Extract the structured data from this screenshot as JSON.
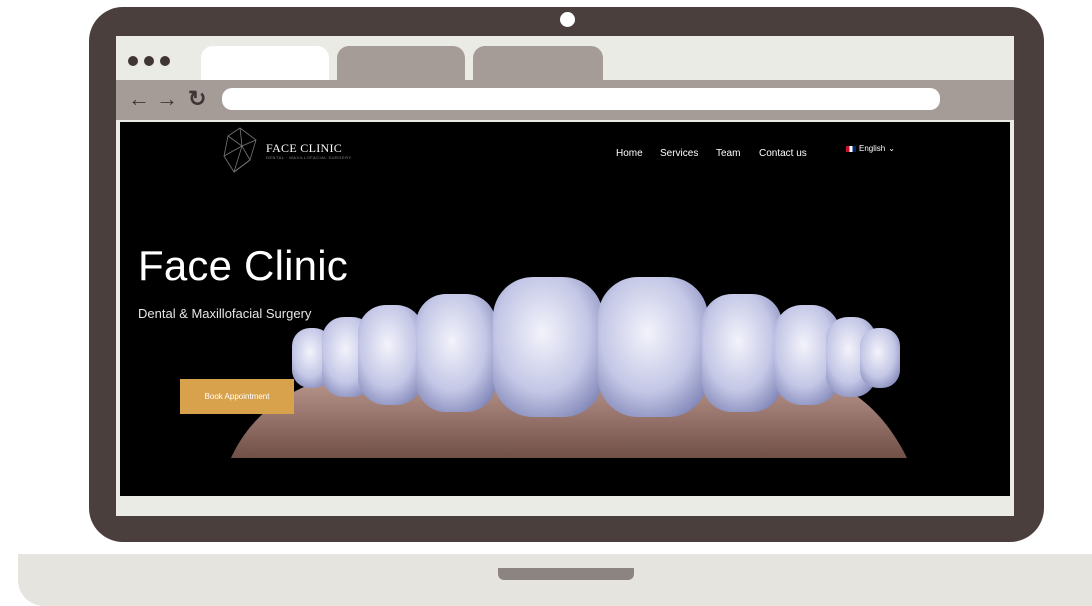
{
  "site": {
    "brand_name": "FACE CLINIC",
    "brand_tagline": "DENTAL · MAXILLOFACIAL SURGERY",
    "nav": [
      "Home",
      "Services",
      "Team",
      "Contact us"
    ],
    "language": "English",
    "language_chevron": "⌄"
  },
  "hero": {
    "title": "Face Clinic",
    "subtitle": "Dental & Maxillofacial Surgery",
    "cta_label": "Book Appointment"
  },
  "browser": {
    "back_icon": "←",
    "forward_icon": "→",
    "reload_icon": "↻",
    "address": ""
  },
  "colors": {
    "frame": "#4a3f3c",
    "chrome": "#a69c97",
    "cta": "#d8a24c"
  },
  "icons": [
    "back-arrow-icon",
    "forward-arrow-icon",
    "reload-icon",
    "uk-flag-icon",
    "chevron-down-icon"
  ]
}
